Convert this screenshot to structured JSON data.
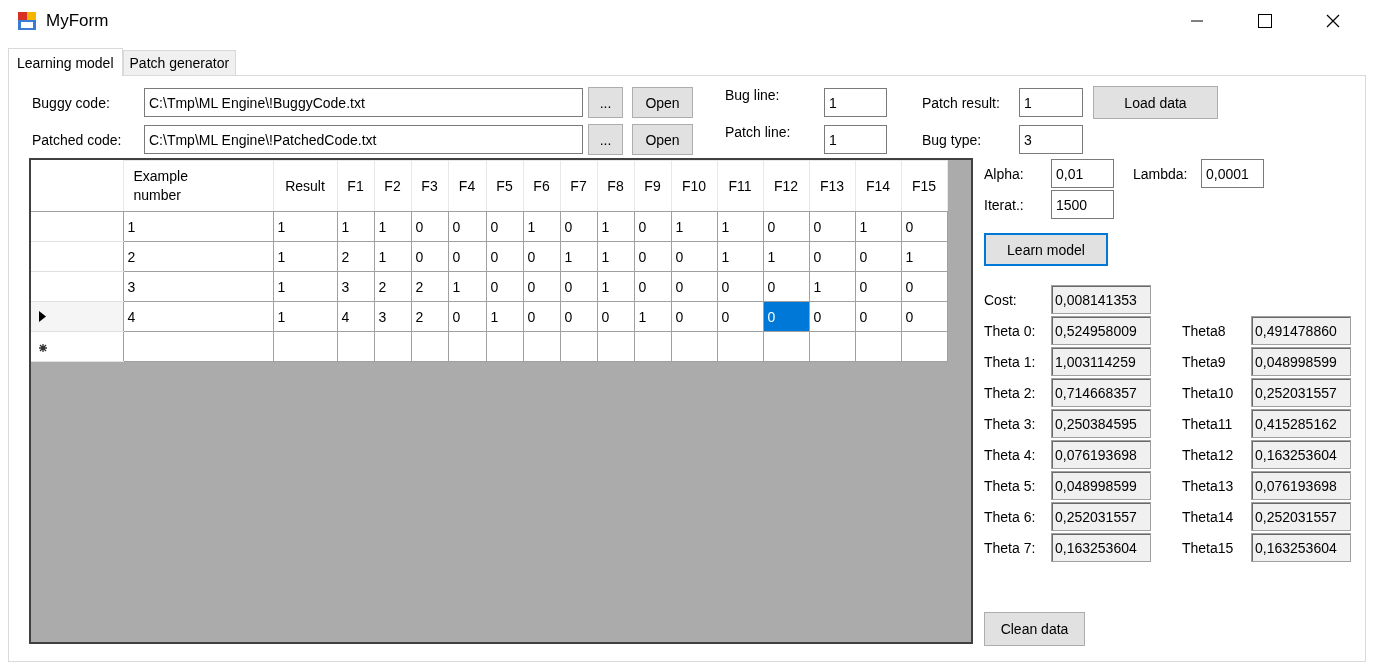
{
  "window": {
    "title": "MyForm"
  },
  "tabs": [
    {
      "label": "Learning model",
      "selected": true
    },
    {
      "label": "Patch generator",
      "selected": false
    }
  ],
  "files": [
    {
      "label": "Buggy code:",
      "value": "C:\\Tmp\\ML Engine\\!BuggyCode.txt",
      "browse": "...",
      "open": "Open"
    },
    {
      "label": "Patched code:",
      "value": "C:\\Tmp\\ML Engine\\!PatchedCode.txt",
      "browse": "...",
      "open": "Open"
    }
  ],
  "line_fields": [
    {
      "label": "Bug line:",
      "value": "1"
    },
    {
      "label": "Patch line:",
      "value": "1"
    }
  ],
  "patch_fields": [
    {
      "label": "Patch result:",
      "value": "1"
    },
    {
      "label": "Bug type:",
      "value": "3"
    }
  ],
  "load_button": "Load data",
  "table": {
    "columns": [
      "Example number",
      "Result",
      "F1",
      "F2",
      "F3",
      "F4",
      "F5",
      "F6",
      "F7",
      "F8",
      "F9",
      "F10",
      "F11",
      "F12",
      "F13",
      "F14",
      "F15"
    ],
    "rows": [
      {
        "current": false,
        "cells": [
          {
            "text": "1",
            "selected": false
          },
          {
            "text": "1",
            "selected": false
          },
          {
            "text": "1",
            "selected": false
          },
          {
            "text": "1",
            "selected": false
          },
          {
            "text": "0",
            "selected": false
          },
          {
            "text": "0",
            "selected": false
          },
          {
            "text": "0",
            "selected": false
          },
          {
            "text": "1",
            "selected": false
          },
          {
            "text": "0",
            "selected": false
          },
          {
            "text": "1",
            "selected": false
          },
          {
            "text": "0",
            "selected": false
          },
          {
            "text": "1",
            "selected": false
          },
          {
            "text": "1",
            "selected": false
          },
          {
            "text": "0",
            "selected": false
          },
          {
            "text": "0",
            "selected": false
          },
          {
            "text": "1",
            "selected": false
          },
          {
            "text": "0",
            "selected": false
          }
        ]
      },
      {
        "current": false,
        "cells": [
          {
            "text": "2",
            "selected": false
          },
          {
            "text": "1",
            "selected": false
          },
          {
            "text": "2",
            "selected": false
          },
          {
            "text": "1",
            "selected": false
          },
          {
            "text": "0",
            "selected": false
          },
          {
            "text": "0",
            "selected": false
          },
          {
            "text": "0",
            "selected": false
          },
          {
            "text": "0",
            "selected": false
          },
          {
            "text": "1",
            "selected": false
          },
          {
            "text": "1",
            "selected": false
          },
          {
            "text": "0",
            "selected": false
          },
          {
            "text": "0",
            "selected": false
          },
          {
            "text": "1",
            "selected": false
          },
          {
            "text": "1",
            "selected": false
          },
          {
            "text": "0",
            "selected": false
          },
          {
            "text": "0",
            "selected": false
          },
          {
            "text": "1",
            "selected": false
          }
        ]
      },
      {
        "current": false,
        "cells": [
          {
            "text": "3",
            "selected": false
          },
          {
            "text": "1",
            "selected": false
          },
          {
            "text": "3",
            "selected": false
          },
          {
            "text": "2",
            "selected": false
          },
          {
            "text": "2",
            "selected": false
          },
          {
            "text": "1",
            "selected": false
          },
          {
            "text": "0",
            "selected": false
          },
          {
            "text": "0",
            "selected": false
          },
          {
            "text": "0",
            "selected": false
          },
          {
            "text": "1",
            "selected": false
          },
          {
            "text": "0",
            "selected": false
          },
          {
            "text": "0",
            "selected": false
          },
          {
            "text": "0",
            "selected": false
          },
          {
            "text": "0",
            "selected": false
          },
          {
            "text": "1",
            "selected": false
          },
          {
            "text": "0",
            "selected": false
          },
          {
            "text": "0",
            "selected": false
          }
        ]
      },
      {
        "current": true,
        "cells": [
          {
            "text": "4",
            "selected": false
          },
          {
            "text": "1",
            "selected": false
          },
          {
            "text": "4",
            "selected": false
          },
          {
            "text": "3",
            "selected": false
          },
          {
            "text": "2",
            "selected": false
          },
          {
            "text": "0",
            "selected": false
          },
          {
            "text": "1",
            "selected": false
          },
          {
            "text": "0",
            "selected": false
          },
          {
            "text": "0",
            "selected": false
          },
          {
            "text": "0",
            "selected": false
          },
          {
            "text": "1",
            "selected": false
          },
          {
            "text": "0",
            "selected": false
          },
          {
            "text": "0",
            "selected": false
          },
          {
            "text": "0",
            "selected": true
          },
          {
            "text": "0",
            "selected": false
          },
          {
            "text": "0",
            "selected": false
          },
          {
            "text": "0",
            "selected": false
          }
        ]
      }
    ],
    "new_row": true
  },
  "params": [
    {
      "label": "Alpha:",
      "value": "0,01"
    },
    {
      "label": "Lambda:",
      "value": "0,0001"
    },
    {
      "label": "Iterat.:",
      "value": "1500"
    }
  ],
  "learn_button": {
    "label": "Learn model",
    "focused": true
  },
  "cost": {
    "label": "Cost:",
    "value": "0,008141353"
  },
  "thetas_left": [
    {
      "label": "Theta 0:",
      "value": "0,524958009"
    },
    {
      "label": "Theta 1:",
      "value": "1,003114259"
    },
    {
      "label": "Theta 2:",
      "value": "0,714668357"
    },
    {
      "label": "Theta 3:",
      "value": "0,250384595"
    },
    {
      "label": "Theta 4:",
      "value": "0,076193698"
    },
    {
      "label": "Theta 5:",
      "value": "0,048998599"
    },
    {
      "label": "Theta 6:",
      "value": "0,252031557"
    },
    {
      "label": "Theta 7:",
      "value": "0,163253604"
    }
  ],
  "thetas_right": [
    {
      "label": "Theta8",
      "value": "0,491478860"
    },
    {
      "label": "Theta9",
      "value": "0,048998599"
    },
    {
      "label": "Theta10",
      "value": "0,252031557"
    },
    {
      "label": "Theta11",
      "value": "0,415285162"
    },
    {
      "label": "Theta12",
      "value": "0,163253604"
    },
    {
      "label": "Theta13",
      "value": "0,076193698"
    },
    {
      "label": "Theta14",
      "value": "0,252031557"
    },
    {
      "label": "Theta15",
      "value": "0,163253604"
    }
  ],
  "clean_button": "Clean data"
}
